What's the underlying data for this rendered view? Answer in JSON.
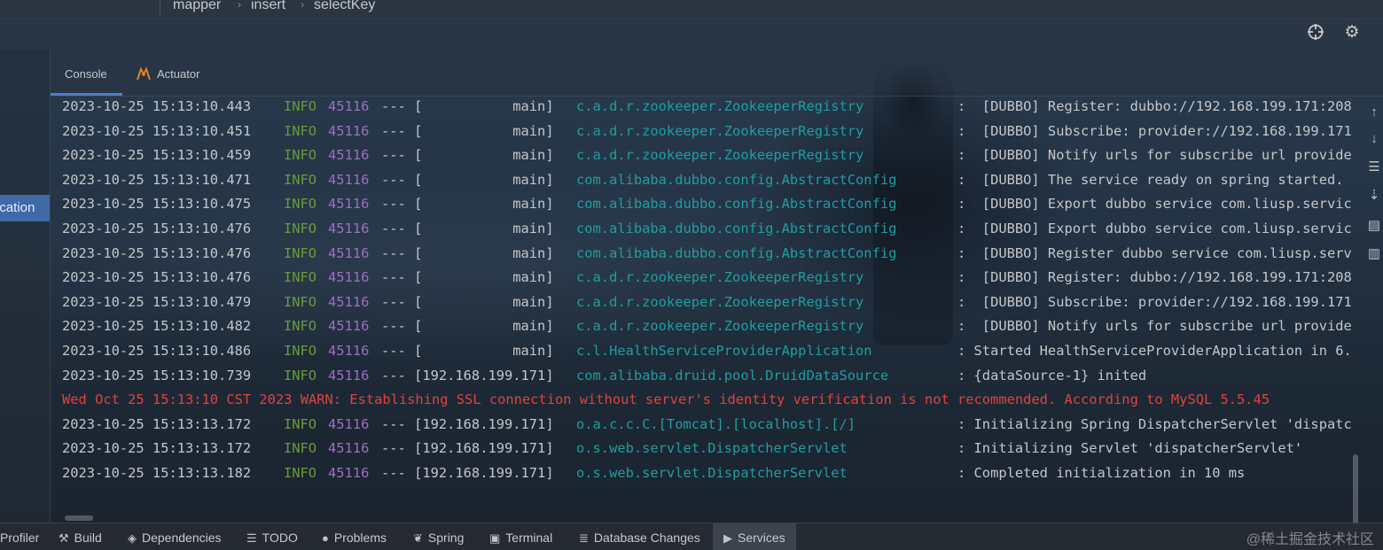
{
  "breadcrumb": [
    "mapper",
    "insert",
    "selectKey"
  ],
  "left_panel": {
    "selected_label": "ication"
  },
  "tabs": [
    {
      "label": "Console",
      "active": true
    },
    {
      "label": "Actuator",
      "active": false
    }
  ],
  "header_icons": [
    "crosshair-icon",
    "gear-icon"
  ],
  "console": {
    "lines": [
      {
        "ts": "2023-10-25 15:13:10.443",
        "level": "INFO",
        "pid": "45116",
        "thread": "--- [           main]",
        "logger": "c.a.d.r.zookeeper.ZookeeperRegistry",
        "message": ":  [DUBBO] Register: dubbo://192.168.199.171:208"
      },
      {
        "ts": "2023-10-25 15:13:10.451",
        "level": "INFO",
        "pid": "45116",
        "thread": "--- [           main]",
        "logger": "c.a.d.r.zookeeper.ZookeeperRegistry",
        "message": ":  [DUBBO] Subscribe: provider://192.168.199.171"
      },
      {
        "ts": "2023-10-25 15:13:10.459",
        "level": "INFO",
        "pid": "45116",
        "thread": "--- [           main]",
        "logger": "c.a.d.r.zookeeper.ZookeeperRegistry",
        "message": ":  [DUBBO] Notify urls for subscribe url provide"
      },
      {
        "ts": "2023-10-25 15:13:10.471",
        "level": "INFO",
        "pid": "45116",
        "thread": "--- [           main]",
        "logger": "com.alibaba.dubbo.config.AbstractConfig",
        "message": ":  [DUBBO] The service ready on spring started."
      },
      {
        "ts": "2023-10-25 15:13:10.475",
        "level": "INFO",
        "pid": "45116",
        "thread": "--- [           main]",
        "logger": "com.alibaba.dubbo.config.AbstractConfig",
        "message": ":  [DUBBO] Export dubbo service com.liusp.servic"
      },
      {
        "ts": "2023-10-25 15:13:10.476",
        "level": "INFO",
        "pid": "45116",
        "thread": "--- [           main]",
        "logger": "com.alibaba.dubbo.config.AbstractConfig",
        "message": ":  [DUBBO] Export dubbo service com.liusp.servic"
      },
      {
        "ts": "2023-10-25 15:13:10.476",
        "level": "INFO",
        "pid": "45116",
        "thread": "--- [           main]",
        "logger": "com.alibaba.dubbo.config.AbstractConfig",
        "message": ":  [DUBBO] Register dubbo service com.liusp.serv"
      },
      {
        "ts": "2023-10-25 15:13:10.476",
        "level": "INFO",
        "pid": "45116",
        "thread": "--- [           main]",
        "logger": "c.a.d.r.zookeeper.ZookeeperRegistry",
        "message": ":  [DUBBO] Register: dubbo://192.168.199.171:208"
      },
      {
        "ts": "2023-10-25 15:13:10.479",
        "level": "INFO",
        "pid": "45116",
        "thread": "--- [           main]",
        "logger": "c.a.d.r.zookeeper.ZookeeperRegistry",
        "message": ":  [DUBBO] Subscribe: provider://192.168.199.171"
      },
      {
        "ts": "2023-10-25 15:13:10.482",
        "level": "INFO",
        "pid": "45116",
        "thread": "--- [           main]",
        "logger": "c.a.d.r.zookeeper.ZookeeperRegistry",
        "message": ":  [DUBBO] Notify urls for subscribe url provide"
      },
      {
        "ts": "2023-10-25 15:13:10.486",
        "level": "INFO",
        "pid": "45116",
        "thread": "--- [           main]",
        "logger": "c.l.HealthServiceProviderApplication",
        "message": ": Started HealthServiceProviderApplication in 6."
      },
      {
        "ts": "2023-10-25 15:13:10.739",
        "level": "INFO",
        "pid": "45116",
        "thread": "--- [192.168.199.171]",
        "logger": "com.alibaba.druid.pool.DruidDataSource",
        "message": ": {dataSource-1} inited"
      },
      {
        "warn": "Wed Oct 25 15:13:10 CST 2023 WARN: Establishing SSL connection without server's identity verification is not recommended. According to MySQL 5.5.45"
      },
      {
        "ts": "2023-10-25 15:13:13.172",
        "level": "INFO",
        "pid": "45116",
        "thread": "--- [192.168.199.171]",
        "logger": "o.a.c.c.C.[Tomcat].[localhost].[/]",
        "message": ": Initializing Spring DispatcherServlet 'dispatc"
      },
      {
        "ts": "2023-10-25 15:13:13.172",
        "level": "INFO",
        "pid": "45116",
        "thread": "--- [192.168.199.171]",
        "logger": "o.s.web.servlet.DispatcherServlet",
        "message": ": Initializing Servlet 'dispatcherServlet'"
      },
      {
        "ts": "2023-10-25 15:13:13.182",
        "level": "INFO",
        "pid": "45116",
        "thread": "--- [192.168.199.171]",
        "logger": "o.s.web.servlet.DispatcherServlet",
        "message": ": Completed initialization in 10 ms"
      }
    ]
  },
  "right_toolbar_icons": [
    "arrow-up-icon",
    "arrow-down-icon",
    "soft-wrap-icon",
    "scroll-to-end-icon",
    "print-icon",
    "trash-icon"
  ],
  "bottom_tabs": [
    {
      "label": "Profiler",
      "icon": "profiler-icon"
    },
    {
      "label": "Build",
      "icon": "hammer-icon"
    },
    {
      "label": "Dependencies",
      "icon": "layers-icon"
    },
    {
      "label": "TODO",
      "icon": "list-icon"
    },
    {
      "label": "Problems",
      "icon": "info-circle-icon"
    },
    {
      "label": "Spring",
      "icon": "leaf-icon"
    },
    {
      "label": "Terminal",
      "icon": "terminal-icon"
    },
    {
      "label": "Database Changes",
      "icon": "database-icon"
    },
    {
      "label": "Services",
      "icon": "services-icon",
      "active": true
    }
  ],
  "watermark": "@稀土掘金技术社区",
  "colors": {
    "info_level": "#6a9a3a",
    "pid": "#9b6fc0",
    "logger": "#1f9e9e",
    "warn": "#e0423d",
    "selection": "#3e6aa8",
    "tab_underline": "#4f7cc9"
  }
}
